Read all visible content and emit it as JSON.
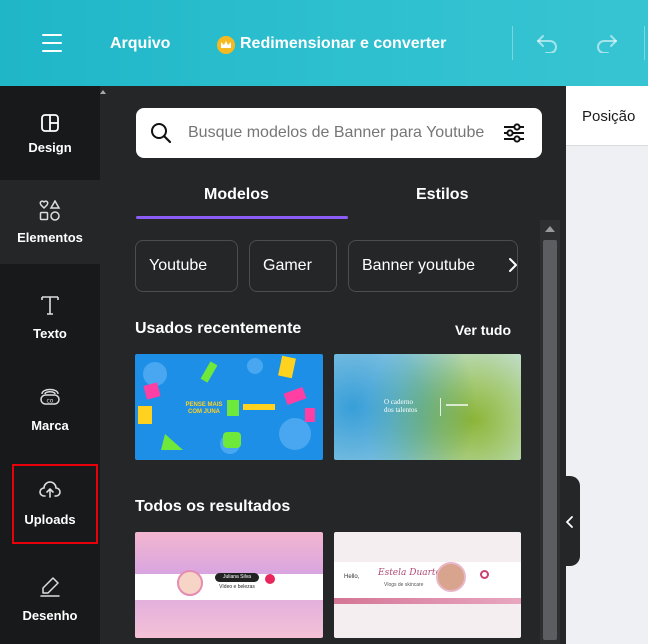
{
  "topbar": {
    "menu_icon": "hamburger-menu-icon",
    "file_label": "Arquivo",
    "resize_icon": "crown-icon",
    "resize_label": "Redimensionar e converter",
    "undo_icon": "undo-icon",
    "redo_icon": "redo-icon",
    "colors": {
      "gradient_start": "#1fb6c8",
      "gradient_end": "#37c4d2"
    }
  },
  "sidebar": {
    "items": [
      {
        "label": "Design",
        "icon": "layout-icon"
      },
      {
        "label": "Elementos",
        "icon": "shapes-icon"
      },
      {
        "label": "Texto",
        "icon": "text-icon"
      },
      {
        "label": "Marca",
        "icon": "brand-icon"
      },
      {
        "label": "Uploads",
        "icon": "cloud-upload-icon"
      },
      {
        "label": "Desenho",
        "icon": "draw-icon"
      }
    ],
    "highlight_color": "#e8000b"
  },
  "panel": {
    "search": {
      "placeholder": "Busque modelos de Banner para Youtube",
      "icon": "search-icon",
      "filter_icon": "filter-sliders-icon"
    },
    "tabs": [
      {
        "label": "Modelos"
      },
      {
        "label": "Estilos"
      }
    ],
    "accent": "#8b5cf6",
    "chips": [
      {
        "label": "Youtube"
      },
      {
        "label": "Gamer"
      },
      {
        "label": "Banner youtube"
      }
    ],
    "chip_next_icon": "chevron-right-icon",
    "recent": {
      "title": "Usados recentemente",
      "see_all": "Ver tudo"
    },
    "all_results": {
      "title": "Todos os resultados"
    },
    "thumbnails": {
      "recent_1_text": "PENSE MAIS COM JUNA",
      "recent_2_text_1": "O caderno",
      "recent_2_text_2": "dos talentos",
      "result_1_name": "Juliana Silva",
      "result_1_tagline": "Vídeo e belezas",
      "result_2_greet": "Hello,",
      "result_2_script": "Estela Duarte",
      "result_2_sub": "Vlogs de skincare"
    }
  },
  "canvas": {
    "toolbar_label": "Posição"
  },
  "collapse_icon": "chevron-left-icon"
}
